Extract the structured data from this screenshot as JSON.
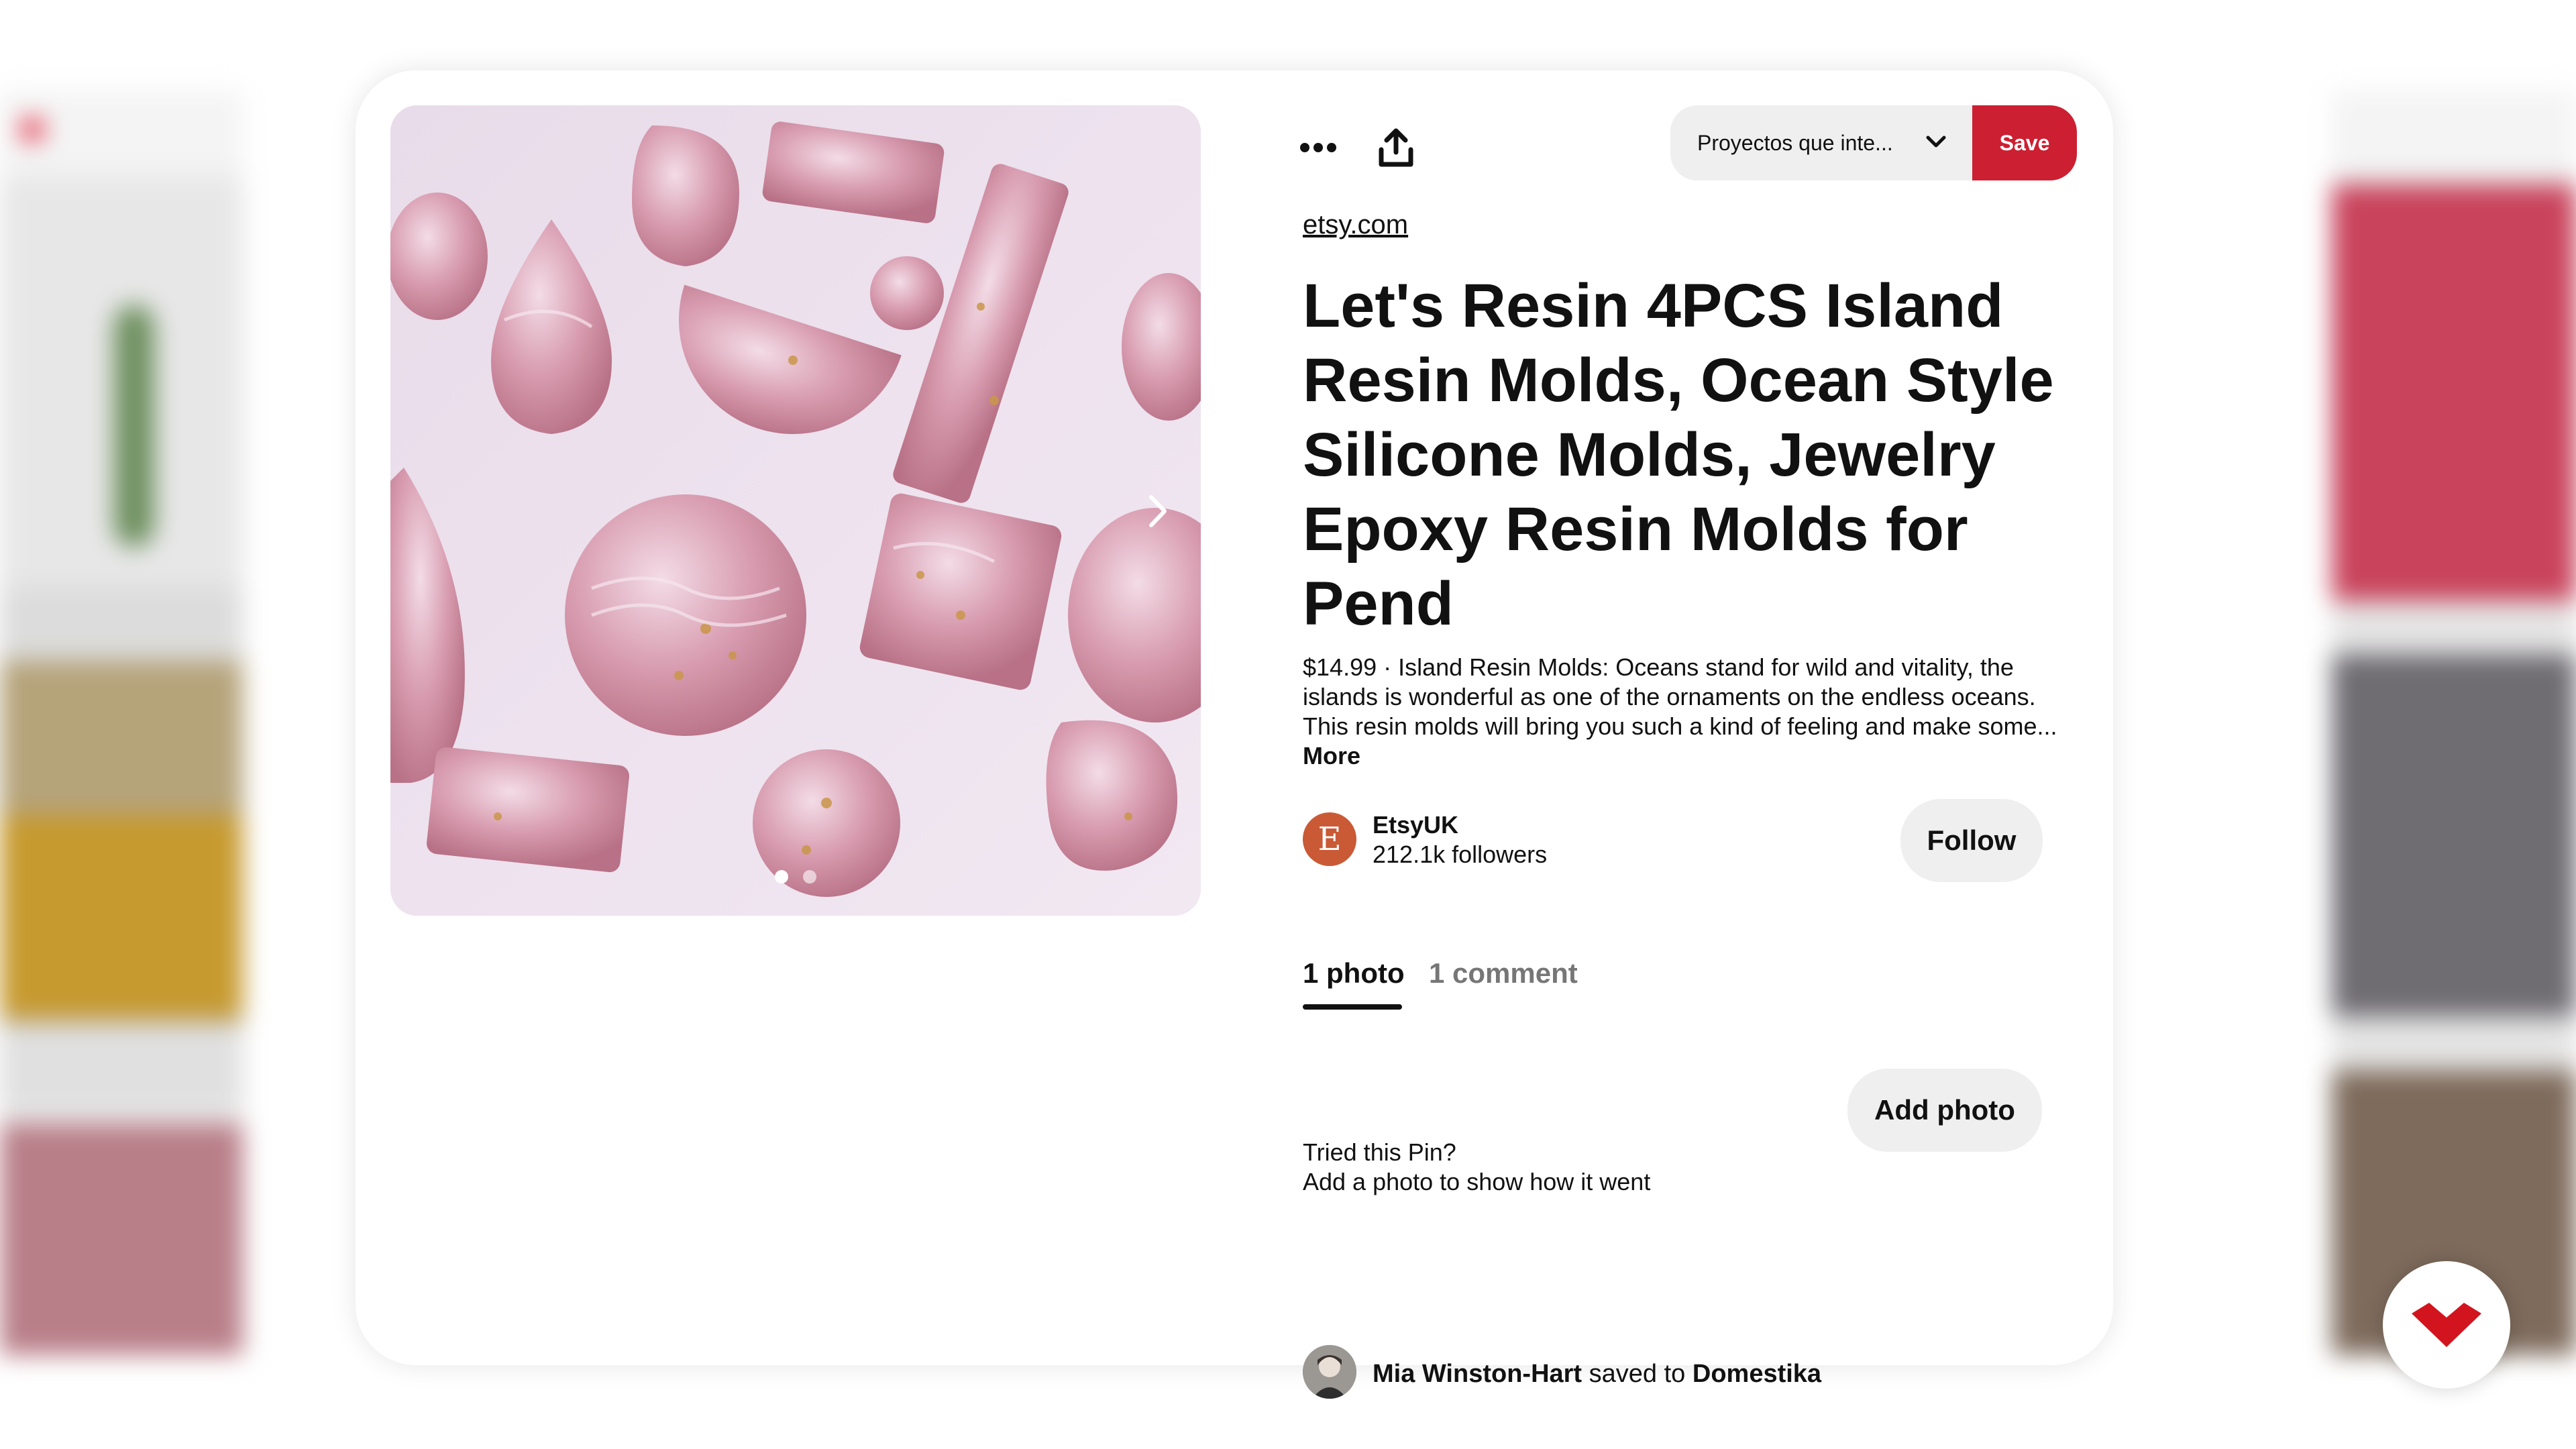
{
  "pin": {
    "source": "etsy.com",
    "title": "Let's Resin 4PCS Island Resin Molds, Ocean Style Silicone Molds, Jewelry Epoxy Resin Molds for Pend",
    "description": "$14.99 · Island Resin Molds: Oceans stand for wild and vitality, the islands is wonderful as one of the ornaments on the endless oceans. This resin molds will bring you such a kind of feeling and make some...",
    "more_label": "More",
    "image_alt": "Pink resin pieces with gold flakes"
  },
  "toolbar": {
    "board_select": "Proyectos que inte...",
    "save_label": "Save",
    "more_icon": "more-horizontal-icon",
    "share_icon": "share-icon"
  },
  "creator": {
    "avatar_letter": "E",
    "name": "EtsyUK",
    "followers": "212.1k followers",
    "follow_label": "Follow"
  },
  "tabs": [
    {
      "label": "1 photo",
      "active": true
    },
    {
      "label": "1 comment",
      "active": false
    }
  ],
  "tried": {
    "title": "Tried this Pin?",
    "subtitle": "Add a photo to show how it went",
    "button": "Add photo"
  },
  "saved_by": {
    "user": "Mia Winston-Hart",
    "text": "saved to",
    "board": "Domestika"
  },
  "carousel": {
    "count": 2,
    "active_index": 0
  },
  "colors": {
    "save_red": "#cc1f31",
    "avatar_orange": "#c95a35",
    "logo_red": "#d2141e"
  }
}
